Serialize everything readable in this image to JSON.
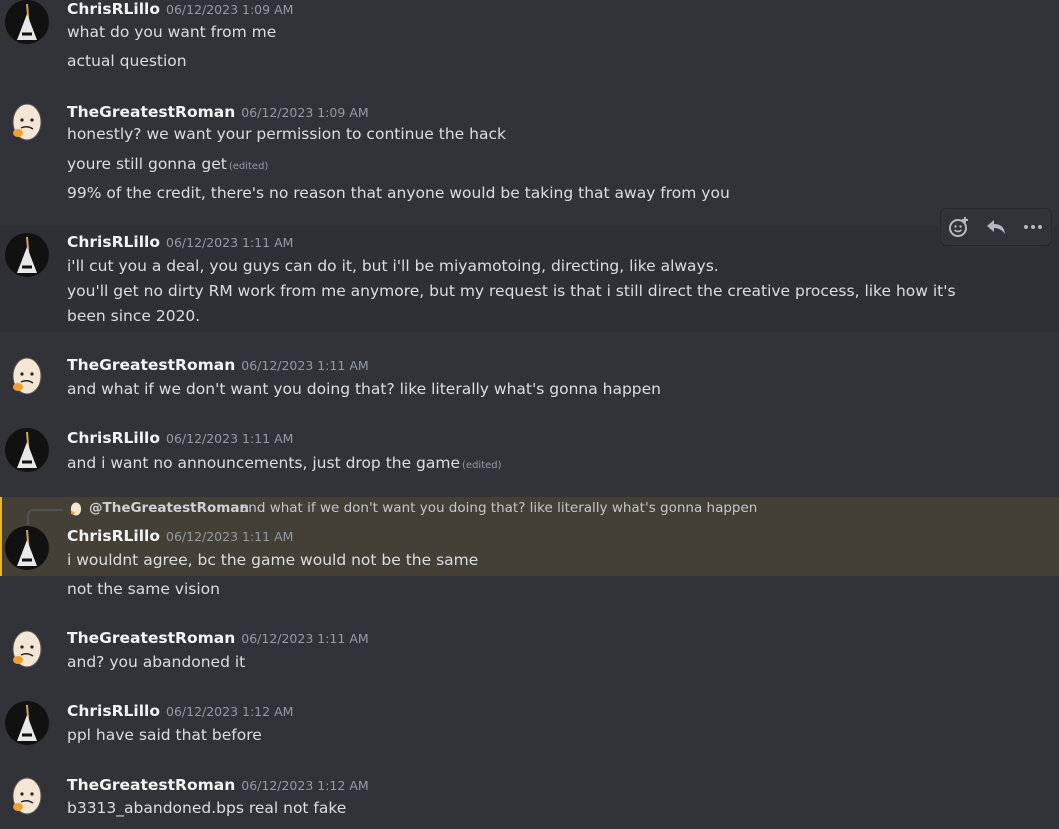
{
  "messages": [
    {
      "author": "ChrisRLillo",
      "time": "06/12/2023 1:09 AM",
      "lines": [
        "what do you want from me",
        "actual question"
      ]
    },
    {
      "author": "TheGreatestRoman",
      "time": "06/12/2023 1:09 AM",
      "lines": [
        "honestly? we want your permission to continue the hack",
        "youre still gonna get",
        "99% of the credit, there's no reason that anyone would be taking that away from you"
      ],
      "edited_line": 1
    },
    {
      "author": "ChrisRLillo",
      "time": "06/12/2023 1:11 AM",
      "lines": [
        "i'll cut you a deal, you guys can do it, but i'll be miyamotoing, directing, like always.",
        "you'll get no dirty RM work from me anymore, but my request is that i still direct the creative process, like how it's been since 2020."
      ]
    },
    {
      "author": "TheGreatestRoman",
      "time": "06/12/2023 1:11 AM",
      "lines": [
        "and what if we don't want you doing that? like literally what's gonna happen"
      ]
    },
    {
      "author": "ChrisRLillo",
      "time": "06/12/2023 1:11 AM",
      "lines": [
        "and i want no announcements, just drop the game"
      ],
      "edited_line": 0
    },
    {
      "author": "ChrisRLillo",
      "time": "06/12/2023 1:11 AM",
      "lines": [
        "i wouldnt agree, bc the game would not be the same",
        "not the same vision"
      ],
      "reply": {
        "name": "@TheGreatestRoman",
        "text": "and what if we don't want you doing that? like literally what's gonna happen"
      }
    },
    {
      "author": "TheGreatestRoman",
      "time": "06/12/2023 1:11 AM",
      "lines": [
        "and? you abandoned it"
      ]
    },
    {
      "author": "ChrisRLillo",
      "time": "06/12/2023 1:12 AM",
      "lines": [
        "ppl have said that before"
      ]
    },
    {
      "author": "TheGreatestRoman",
      "time": "06/12/2023 1:12 AM",
      "lines": [
        "b3313_abandoned.bps real not fake"
      ]
    }
  ],
  "edited_label": "(edited)",
  "toolbar": {
    "icons": [
      "add-reaction-icon",
      "reply-icon",
      "more-icon"
    ]
  },
  "colors": {
    "background": "#313338",
    "hover": "#2e3035",
    "mention_highlight": "#444036",
    "author": "#f2f3f5",
    "timestamp": "#949ba4"
  }
}
